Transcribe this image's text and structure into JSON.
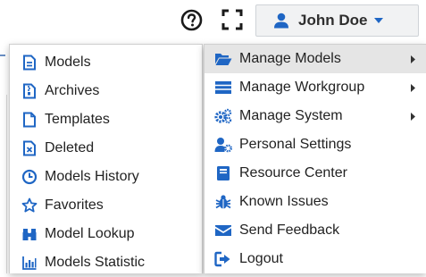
{
  "colors": {
    "accent_blue": "#1f66c4",
    "text_dark": "#222222",
    "active_bg": "#e5e5e5"
  },
  "header": {
    "help_icon": "question-circle-icon",
    "fullscreen_icon": "fullscreen-icon",
    "user": {
      "icon": "user-icon",
      "name": "John Doe",
      "caret_icon": "caret-down-icon"
    }
  },
  "left_menu": {
    "items": [
      {
        "label": "Models",
        "icon": "file-icon"
      },
      {
        "label": "Archives",
        "icon": "archive-file-icon"
      },
      {
        "label": "Templates",
        "icon": "template-file-icon"
      },
      {
        "label": "Deleted",
        "icon": "deleted-file-icon"
      },
      {
        "label": "Models History",
        "icon": "clock-icon"
      },
      {
        "label": "Favorites",
        "icon": "star-icon"
      },
      {
        "label": "Model Lookup",
        "icon": "binoculars-icon"
      },
      {
        "label": "Models Statistic",
        "icon": "bar-chart-icon"
      }
    ]
  },
  "right_menu": {
    "items": [
      {
        "label": "Manage Models",
        "icon": "folder-open-icon",
        "submenu": true,
        "active": true
      },
      {
        "label": "Manage Workgroup",
        "icon": "list-icon",
        "submenu": true
      },
      {
        "label": "Manage System",
        "icon": "cogs-icon",
        "submenu": true
      },
      {
        "label": "Personal Settings",
        "icon": "user-cog-icon"
      },
      {
        "label": "Resource Center",
        "icon": "book-icon"
      },
      {
        "label": "Known Issues",
        "icon": "bug-icon"
      },
      {
        "label": "Send Feedback",
        "icon": "envelope-icon"
      },
      {
        "label": "Logout",
        "icon": "sign-out-icon"
      }
    ]
  }
}
